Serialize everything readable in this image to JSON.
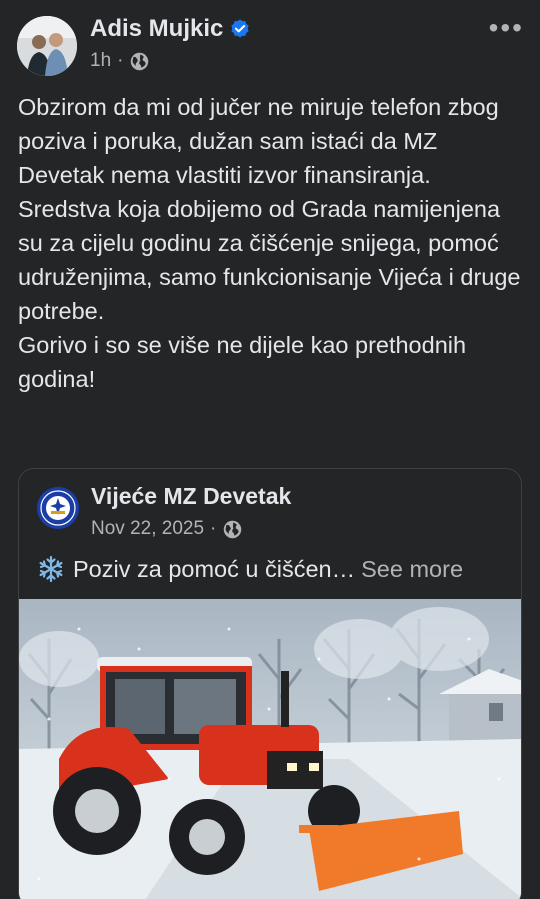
{
  "post": {
    "author": "Adis Mujkic",
    "time": "1h",
    "separator": "·",
    "more_icon": "more-horizontal-icon",
    "paragraphs": [
      "Obzirom da mi od jučer ne miruje telefon zbog poziva i poruka, dužan sam istaći da MZ Devetak nema vlastiti izvor finansiranja.",
      "Sredstva koja dobijemo od Grada namijenjena su za cijelu godinu za čišćenje snijega, pomoć udruženjima, samo funkcionisanje Vijeća i druge potrebe.",
      "Gorivo i so se više ne dijele kao prethodnih godina!"
    ]
  },
  "shared": {
    "page_name": "Vijeće MZ Devetak",
    "date": "Nov 22, 2025",
    "separator": "·",
    "preview_text": "Poziv za pomoć u čišćen…",
    "see_more": "See more"
  },
  "colors": {
    "background": "#242526",
    "verified": "#1877f2",
    "tractor": "#d8321c",
    "plow": "#f07a2a"
  }
}
